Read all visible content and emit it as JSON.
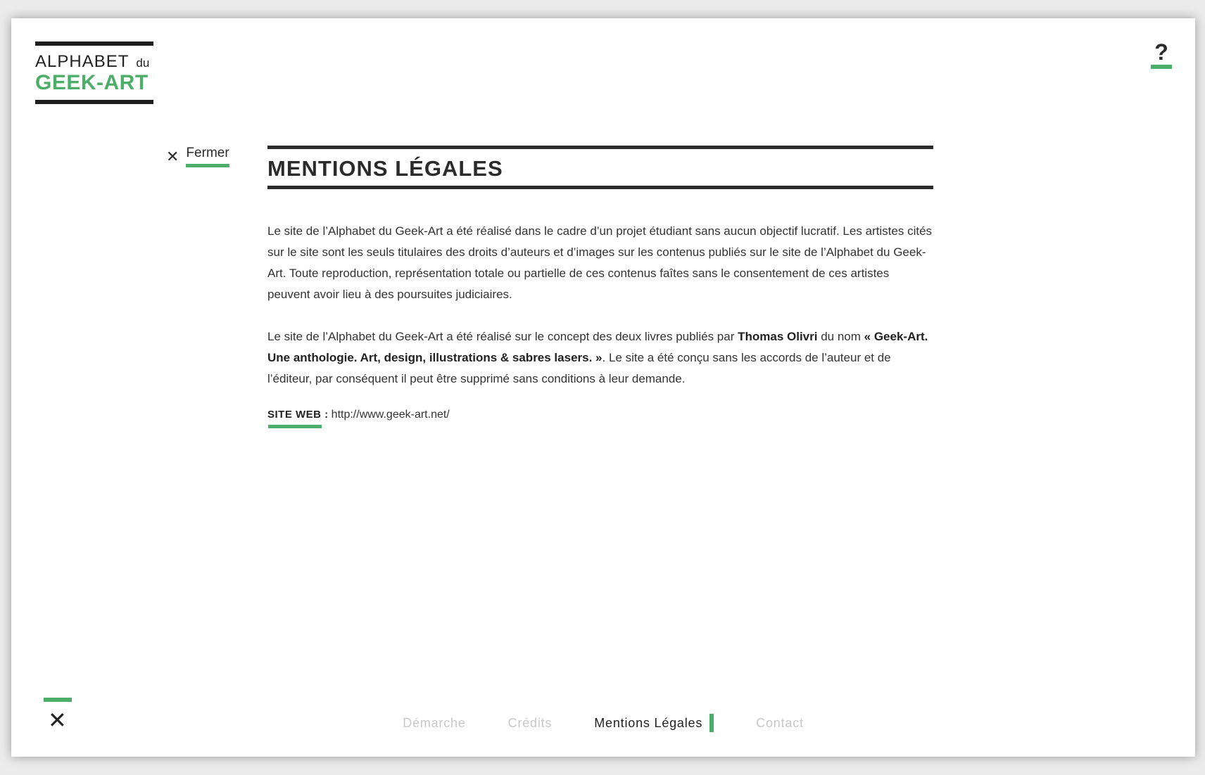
{
  "logo": {
    "line1": "ALPHABET",
    "line1_small": "du",
    "line2": "GEEK-ART"
  },
  "help": {
    "icon": "question-mark-icon",
    "label": "?"
  },
  "close": {
    "icon": "close-icon",
    "icon_glyph": "✕",
    "label": "Fermer"
  },
  "page": {
    "title": "MENTIONS LÉGALES",
    "paragraph1": "Le site de l’Alphabet du Geek-Art a été réalisé dans le cadre d’un projet étudiant sans aucun objectif lucratif. Les artistes cités sur le site sont les seuls titulaires des droits d’auteurs et d’images sur les contenus publiés sur le site de l’Alphabet du Geek-Art. Toute reproduction, représentation totale ou partielle de ces contenus faîtes sans le consentement de ces artistes peuvent avoir lieu à des poursuites judiciaires.",
    "paragraph2_a": "Le site de l’Alphabet du Geek-Art a été réalisé sur le concept des deux livres publiés par ",
    "paragraph2_author": "Thomas Olivri",
    "paragraph2_b": " du nom ",
    "paragraph2_book": "« Geek-Art. Une anthologie. Art, design, illustrations & sabres lasers. »",
    "paragraph2_c": ". Le site a été conçu sans les accords de l’auteur et de l’éditeur, par conséquent il peut être supprimé sans conditions à leur demande.",
    "site_web_label": "SITE WEB :",
    "site_web_url": "http://www.geek-art.net/"
  },
  "bottom_close": {
    "icon": "close-icon",
    "glyph": "✕"
  },
  "footer_nav": {
    "items": [
      {
        "label": "Démarche",
        "active": false
      },
      {
        "label": "Crédits",
        "active": false
      },
      {
        "label": "Mentions Légales",
        "active": true
      },
      {
        "label": "Contact",
        "active": false
      }
    ]
  },
  "colors": {
    "accent": "#4cae68",
    "text": "#2b2b2b",
    "inactive": "#c8c8c8"
  }
}
